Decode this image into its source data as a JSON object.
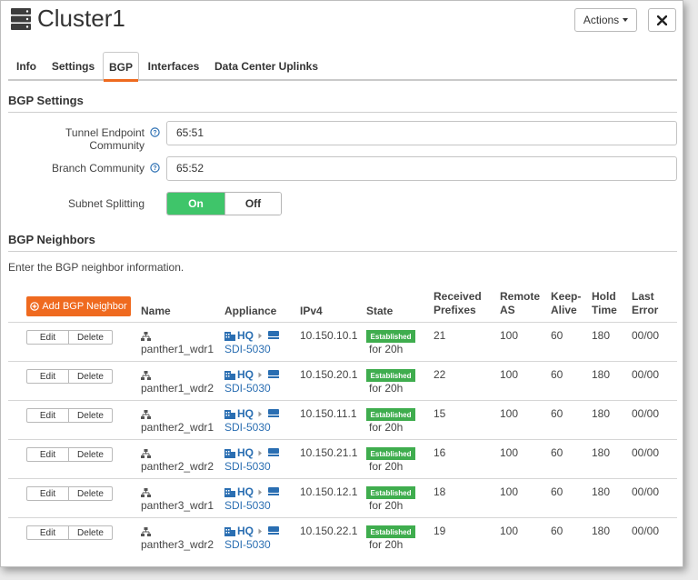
{
  "header": {
    "title": "Cluster1",
    "actions_label": "Actions",
    "icons": {
      "cluster": "server-stack-icon",
      "close": "close-icon",
      "caret": "caret-down-icon"
    }
  },
  "tabs": [
    {
      "label": "Info",
      "active": false
    },
    {
      "label": "Settings",
      "active": false
    },
    {
      "label": "BGP",
      "active": true
    },
    {
      "label": "Interfaces",
      "active": false
    },
    {
      "label": "Data Center Uplinks",
      "active": false
    }
  ],
  "bgp_settings": {
    "title": "BGP Settings",
    "tunnel_endpoint_community": {
      "label": "Tunnel Endpoint Community",
      "value": "65:51"
    },
    "branch_community": {
      "label": "Branch Community",
      "value": "65:52"
    },
    "subnet_splitting": {
      "label": "Subnet Splitting",
      "on_label": "On",
      "off_label": "Off",
      "selected": "On"
    }
  },
  "bgp_neighbors": {
    "title": "BGP Neighbors",
    "intro": "Enter the BGP neighbor information.",
    "add_button_label": "Add BGP Neighbor",
    "columns": {
      "name": "Name",
      "appliance": "Appliance",
      "ipv4": "IPv4",
      "state": "State",
      "received_prefixes": [
        "Received",
        "Prefixes"
      ],
      "remote_as": [
        "Remote",
        "AS"
      ],
      "keep_alive": [
        "Keep-",
        "Alive"
      ],
      "hold_time": [
        "Hold",
        "Time"
      ],
      "last_error": [
        "Last",
        "Error"
      ]
    },
    "edit_label": "Edit",
    "delete_label": "Delete",
    "rows": [
      {
        "name": "panther1_wdr1",
        "site": "HQ",
        "appliance": "SDI-5030",
        "ipv4": "10.150.10.1",
        "state": "Established",
        "state_time": "for 20h",
        "received_prefixes": "21",
        "remote_as": "100",
        "keep_alive": "60",
        "hold_time": "180",
        "last_error": "00/00"
      },
      {
        "name": "panther1_wdr2",
        "site": "HQ",
        "appliance": "SDI-5030",
        "ipv4": "10.150.20.1",
        "state": "Established",
        "state_time": "for 20h",
        "received_prefixes": "22",
        "remote_as": "100",
        "keep_alive": "60",
        "hold_time": "180",
        "last_error": "00/00"
      },
      {
        "name": "panther2_wdr1",
        "site": "HQ",
        "appliance": "SDI-5030",
        "ipv4": "10.150.11.1",
        "state": "Established",
        "state_time": "for 20h",
        "received_prefixes": "15",
        "remote_as": "100",
        "keep_alive": "60",
        "hold_time": "180",
        "last_error": "00/00"
      },
      {
        "name": "panther2_wdr2",
        "site": "HQ",
        "appliance": "SDI-5030",
        "ipv4": "10.150.21.1",
        "state": "Established",
        "state_time": "for 20h",
        "received_prefixes": "16",
        "remote_as": "100",
        "keep_alive": "60",
        "hold_time": "180",
        "last_error": "00/00"
      },
      {
        "name": "panther3_wdr1",
        "site": "HQ",
        "appliance": "SDI-5030",
        "ipv4": "10.150.12.1",
        "state": "Established",
        "state_time": "for 20h",
        "received_prefixes": "18",
        "remote_as": "100",
        "keep_alive": "60",
        "hold_time": "180",
        "last_error": "00/00"
      },
      {
        "name": "panther3_wdr2",
        "site": "HQ",
        "appliance": "SDI-5030",
        "ipv4": "10.150.22.1",
        "state": "Established",
        "state_time": "for 20h",
        "received_prefixes": "19",
        "remote_as": "100",
        "keep_alive": "60",
        "hold_time": "180",
        "last_error": "00/00"
      }
    ]
  },
  "colors": {
    "accent": "#ef6a1f",
    "toggle_on": "#3fc56a",
    "established": "#3fad4e",
    "link": "#2a6eb2"
  }
}
